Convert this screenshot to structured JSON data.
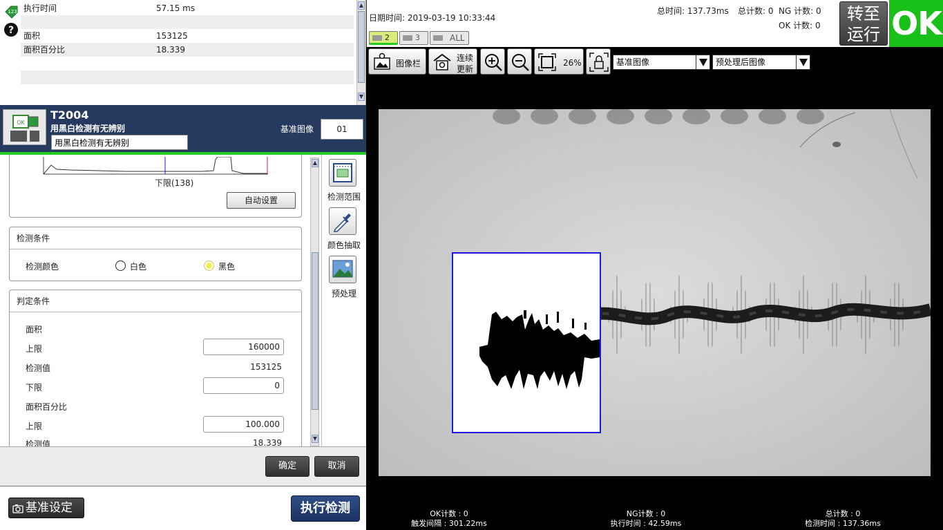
{
  "results": {
    "rows": [
      {
        "key": "执行时间",
        "value": "57.15 ms"
      },
      {
        "key": "",
        "value": ""
      },
      {
        "key": "面积",
        "value": "153125"
      },
      {
        "key": "面积百分比",
        "value": "18.339"
      },
      {
        "key": "",
        "value": ""
      },
      {
        "key": "",
        "value": ""
      },
      {
        "key": "",
        "value": ""
      }
    ]
  },
  "tool": {
    "id": "T2004",
    "subtitle": "用黑白检测有无辨别",
    "name_value": "用黑白检测有无辨别",
    "ref_label": "基准图像",
    "ref_value": "01"
  },
  "histogram": {
    "lower_label": "下限(138)",
    "auto_button": "自动设置"
  },
  "detection": {
    "title": "检测条件",
    "color_label": "检测颜色",
    "white": "白色",
    "black": "黑色",
    "selected": "black"
  },
  "judgement": {
    "title": "判定条件",
    "area_label": "面积",
    "upper_label": "上限",
    "upper_value": "160000",
    "measured_label": "检测值",
    "measured_value": "153125",
    "lower_label": "下限",
    "lower_value": "0",
    "pct_label": "面积百分比",
    "pct_upper_label": "上限",
    "pct_upper_value": "100.000",
    "pct_measured_label": "检测值",
    "pct_measured_value": "18.339"
  },
  "rail": {
    "range": "检测范围",
    "color_pick": "颜色抽取",
    "preprocess": "预处理"
  },
  "dialog": {
    "ok": "确定",
    "cancel": "取消"
  },
  "bottom": {
    "ref_setting": "基准设定",
    "execute": "执行检测"
  },
  "viewer": {
    "datetime": "日期时间: 2019-03-19 10:33:44",
    "total_time": "总时间:  137.73ms",
    "total_count": "总计数: 0",
    "ng_count": "NG 计数: 0",
    "ok_count": "OK 计数: 0",
    "tabs": [
      "2",
      "3",
      "ALL"
    ],
    "run_button_line1": "转至",
    "run_button_line2": "运行",
    "result": "OK",
    "toolbar": {
      "image_bar": "图像栏",
      "continuous_line1": "连续",
      "continuous_line2": "更新",
      "zoom": "26%",
      "select1": "基准图像",
      "select2": "预处理后图像"
    }
  },
  "status": {
    "ok_count": "OK计数 : 0",
    "trigger_interval": "触发间隔 : 301.22ms",
    "ng_count": "NG计数 : 0",
    "exec_time": "执行时间 : 42.59ms",
    "total_count": "总计数 : 0",
    "detect_time": "检测时间 : 137.36ms"
  },
  "colors": {
    "header_bg": "#253a5e",
    "ok_green": "#18c018",
    "roi_blue": "#1a1adf"
  }
}
